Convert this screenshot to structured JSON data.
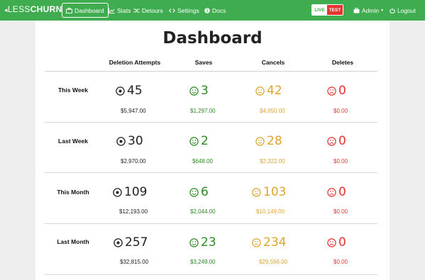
{
  "brand": {
    "arrow": "◂",
    "part1": "LESS",
    "part2": "CHURN"
  },
  "nav": {
    "dashboard": "Dashboard",
    "stats": "Stats",
    "detours": "Detours",
    "settings": "Settings",
    "docs": "Docs",
    "admin": "Admin",
    "admin_caret": "▾",
    "logout": "Logout"
  },
  "env": {
    "live": "LIVE",
    "test": "TEST"
  },
  "page": {
    "title": "Dashboard"
  },
  "table": {
    "headers": [
      "Deletion Attempts",
      "Saves",
      "Cancels",
      "Deletes"
    ],
    "rows": [
      {
        "label": "This Week",
        "attempts": "45",
        "attempts_money": "$5,947.00",
        "saves": "3",
        "saves_money": "$1,297.00",
        "cancels": "42",
        "cancels_money": "$4,650.00",
        "deletes": "0",
        "deletes_money": "$0.00"
      },
      {
        "label": "Last Week",
        "attempts": "30",
        "attempts_money": "$2,970.00",
        "saves": "2",
        "saves_money": "$648.00",
        "cancels": "28",
        "cancels_money": "$2,322.00",
        "deletes": "0",
        "deletes_money": "$0.00"
      },
      {
        "label": "This Month",
        "attempts": "109",
        "attempts_money": "$12,193.00",
        "saves": "6",
        "saves_money": "$2,044.00",
        "cancels": "103",
        "cancels_money": "$10,149.00",
        "deletes": "0",
        "deletes_money": "$0.00"
      },
      {
        "label": "Last Month",
        "attempts": "257",
        "attempts_money": "$32,815.00",
        "saves": "23",
        "saves_money": "$3,249.00",
        "cancels": "234",
        "cancels_money": "$29,566.00",
        "deletes": "0",
        "deletes_money": "$0.00"
      }
    ]
  },
  "colors": {
    "navbar": "#3eac4f",
    "saves": "#2d8a22",
    "cancels": "#e0a42e",
    "deletes": "#e3342f",
    "test_badge": "#e3342f"
  }
}
